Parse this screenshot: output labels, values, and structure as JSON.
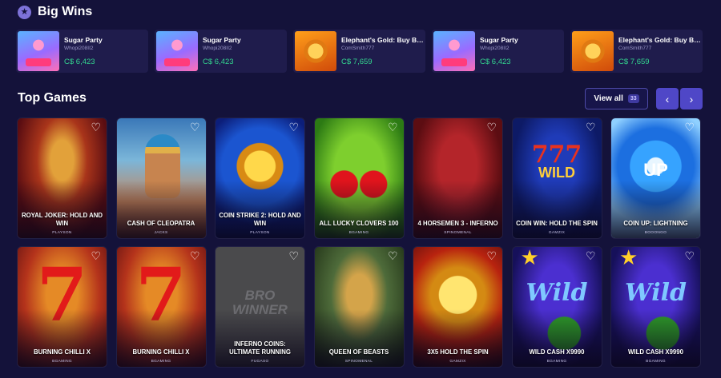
{
  "big_wins": {
    "title": "Big Wins",
    "items": [
      {
        "game": "Sugar Party",
        "user": "Whopi208II2",
        "amount": "C$ 6,423",
        "thumb": "sugar"
      },
      {
        "game": "Sugar Party",
        "user": "Whopi208II2",
        "amount": "C$ 6,423",
        "thumb": "sugar"
      },
      {
        "game": "Elephant's Gold: Buy Bo...",
        "user": "ComSmith777",
        "amount": "C$ 7,659",
        "thumb": "gold"
      },
      {
        "game": "Sugar Party",
        "user": "Whopi208II2",
        "amount": "C$ 6,423",
        "thumb": "sugar"
      },
      {
        "game": "Elephant's Gold: Buy Bo...",
        "user": "ComSmith777",
        "amount": "C$ 7,659",
        "thumb": "gold"
      }
    ]
  },
  "top_games": {
    "title": "Top Games",
    "view_all_label": "View all",
    "view_all_count": "33",
    "prev_icon": "‹",
    "next_icon": "›",
    "games": [
      {
        "name": "ROYAL JOKER: HOLD AND WIN",
        "provider": "PLAYSON",
        "art": "joker"
      },
      {
        "name": "CASH OF CLEOPATRA",
        "provider": "JACKS",
        "art": "cleo"
      },
      {
        "name": "COIN STRIKE 2: HOLD AND WIN",
        "provider": "PLAYSON",
        "art": "strike"
      },
      {
        "name": "ALL LUCKY CLOVERS 100",
        "provider": "BGAMING",
        "art": "clover"
      },
      {
        "name": "4 HORSEMEN 3 - INFERNO",
        "provider": "SPINOMENAL",
        "art": "horse"
      },
      {
        "name": "COIN WIN: HOLD THE SPIN",
        "provider": "GAMZIX",
        "art": "coinwin"
      },
      {
        "name": "COIN UP: LIGHTNING",
        "provider": "BOOONGO",
        "art": "coinup"
      },
      {
        "name": "BURNING CHILLI X",
        "provider": "BGAMING",
        "art": "chilli"
      },
      {
        "name": "BURNING CHILLI X",
        "provider": "BGAMING",
        "art": "chilli"
      },
      {
        "name": "INFERNO COINS: ULTIMATE RUNNING",
        "provider": "FUGASO",
        "art": "bro"
      },
      {
        "name": "QUEEN OF BEASTS",
        "provider": "SPINOMENAL",
        "art": "beasts"
      },
      {
        "name": "3X5 HOLD THE SPIN",
        "provider": "GAMZIX",
        "art": "3x5"
      },
      {
        "name": "WILD CASH X9990",
        "provider": "BGAMING",
        "art": "wildcash"
      },
      {
        "name": "WILD CASH X9990",
        "provider": "BGAMING",
        "art": "wildcash"
      }
    ]
  },
  "icons": {
    "star": "star-icon",
    "heart": "heart-icon"
  },
  "colors": {
    "background": "#14123a",
    "win_amount": "#33d58f",
    "nav_button": "#4f47c7"
  }
}
